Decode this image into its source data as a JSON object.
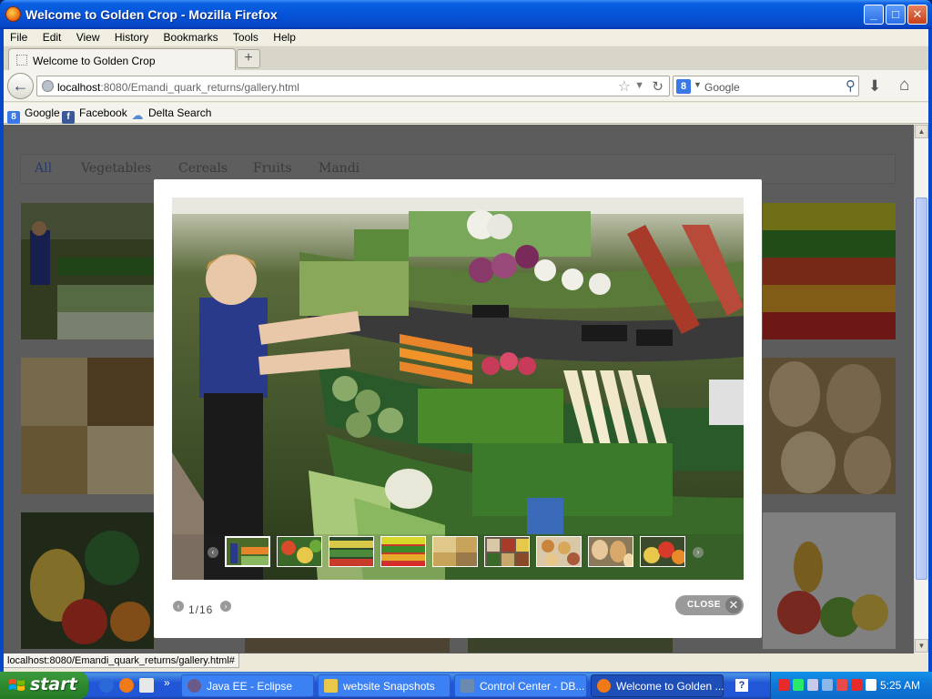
{
  "window": {
    "title": "Welcome to Golden Crop - Mozilla Firefox",
    "minimize": "_",
    "maximize": "□",
    "close": "✕"
  },
  "menu": [
    "File",
    "Edit",
    "View",
    "History",
    "Bookmarks",
    "Tools",
    "Help"
  ],
  "tab": {
    "label": "Welcome to Golden Crop",
    "new_tab": "+"
  },
  "nav": {
    "url_host": "localhost",
    "url_rest": ":8080/Emandi_quark_returns/gallery.html",
    "search_placeholder": "Google",
    "search_engine_icon": "8"
  },
  "bookmarks": [
    {
      "label": "Google",
      "icon": "google-bookmark-icon",
      "color": "#3b78e7"
    },
    {
      "label": "Facebook",
      "icon": "facebook-icon",
      "color": "#3b5998"
    },
    {
      "label": "Delta Search",
      "icon": "delta-search-icon",
      "color": "#5a8ad0"
    }
  ],
  "page": {
    "filters": [
      "All",
      "Vegetables",
      "Cereals",
      "Fruits",
      "Mandi"
    ],
    "active_filter": "All"
  },
  "lightbox": {
    "counter": "1/16",
    "close_label": "CLOSE",
    "current_index": 1,
    "total": 16,
    "thumbnail_count": 9
  },
  "status": {
    "text": "localhost:8080/Emandi_quark_returns/gallery.html#"
  },
  "taskbar": {
    "start_label": "start",
    "overflow": "»",
    "tasks": [
      {
        "label": "Java EE - Eclipse",
        "icon_color": "#6a5a8a"
      },
      {
        "label": "website Snapshots",
        "icon_color": "#e8c84a"
      },
      {
        "label": "Control Center - DB...",
        "icon_color": "#6a8ab0"
      },
      {
        "label": "Welcome to Golden ...",
        "icon_color": "#f07a18"
      }
    ],
    "help_icon": "?",
    "clock": "5:25 AM"
  }
}
